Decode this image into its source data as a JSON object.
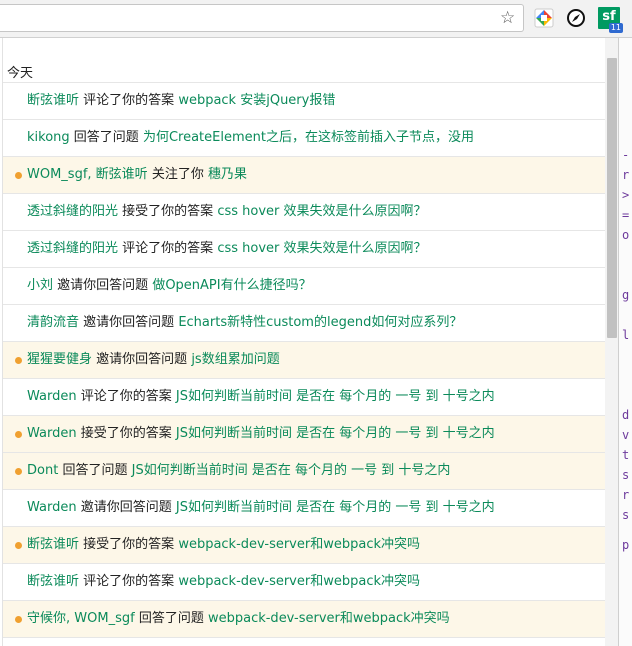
{
  "toolbar": {
    "star_icon": "star-icon",
    "extension_sf_label": "sf",
    "extension_sf_badge": "11"
  },
  "popup": {
    "section_title": "今天",
    "notifications": [
      {
        "unread": false,
        "actors": "断弦谁听",
        "action": "评论了你的答案",
        "subject": "webpack 安装jQuery报错"
      },
      {
        "unread": false,
        "actors": "kikong",
        "action": "回答了问题",
        "subject": "为何CreateElement之后，在这标签前插入子节点，没用"
      },
      {
        "unread": true,
        "actors": "WOM_sgf, 断弦谁听",
        "action": "关注了你",
        "subject": "穗乃果"
      },
      {
        "unread": false,
        "actors": "透过斜缝的阳光",
        "action": "接受了你的答案",
        "subject": "css hover 效果失效是什么原因啊？"
      },
      {
        "unread": false,
        "actors": "透过斜缝的阳光",
        "action": "评论了你的答案",
        "subject": "css hover 效果失效是什么原因啊？"
      },
      {
        "unread": false,
        "actors": "小刘",
        "action": "邀请你回答问题",
        "subject": "做OpenAPI有什么捷径吗？"
      },
      {
        "unread": false,
        "actors": "清韵流音",
        "action": "邀请你回答问题",
        "subject": "Echarts新特性custom的legend如何对应系列？"
      },
      {
        "unread": true,
        "actors": "猩猩要健身",
        "action": "邀请你回答问题",
        "subject": "js数组累加问题"
      },
      {
        "unread": false,
        "actors": "Warden",
        "action": "评论了你的答案",
        "subject": "JS如何判断当前时间 是否在 每个月的 一号 到 十号之内"
      },
      {
        "unread": true,
        "actors": "Warden",
        "action": "接受了你的答案",
        "subject": "JS如何判断当前时间 是否在 每个月的 一号 到 十号之内"
      },
      {
        "unread": true,
        "actors": "Dont",
        "action": "回答了问题",
        "subject": "JS如何判断当前时间 是否在 每个月的 一号 到 十号之内"
      },
      {
        "unread": false,
        "actors": "Warden",
        "action": "邀请你回答问题",
        "subject": "JS如何判断当前时间 是否在 每个月的 一号 到 十号之内"
      },
      {
        "unread": true,
        "actors": "断弦谁听",
        "action": "接受了你的答案",
        "subject": "webpack-dev-server和webpack冲突吗"
      },
      {
        "unread": false,
        "actors": "断弦谁听",
        "action": "评论了你的答案",
        "subject": "webpack-dev-server和webpack冲突吗"
      },
      {
        "unread": true,
        "actors": "守候你, WOM_sgf",
        "action": "回答了问题",
        "subject": "webpack-dev-server和webpack冲突吗"
      }
    ]
  },
  "colors": {
    "link": "#0b8a5a",
    "unread_bg": "#fdf7e8",
    "unread_dot": "#f0a030",
    "brand_sf": "#009a61"
  }
}
